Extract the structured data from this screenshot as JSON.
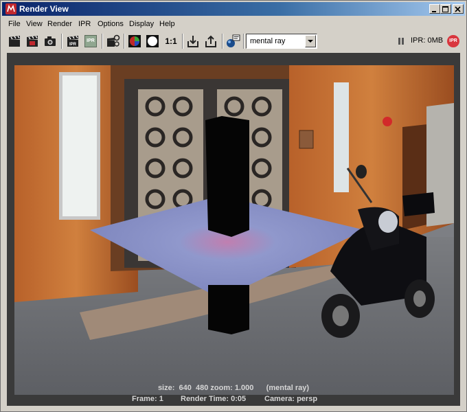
{
  "window": {
    "title": "Render View"
  },
  "menu": [
    "File",
    "View",
    "Render",
    "IPR",
    "Options",
    "Display",
    "Help"
  ],
  "toolbar": {
    "one_to_one_label": "1:1",
    "renderer": "mental ray",
    "ipr_memory": "IPR: 0MB",
    "ipr_badge": "IPR",
    "ipr_icon_text": "IPR"
  },
  "render_info": {
    "size_zoom": "size:  640  480 zoom: 1.000      (mental ray)"
  },
  "status": {
    "frame": "Frame: 1",
    "render_time": "Render Time: 0:05",
    "camera": "Camera: persp"
  },
  "colors": {
    "title_bar": "#0a246a",
    "window_bg": "#d4d0c8",
    "viewport_bg": "#3a3a3a",
    "ground_plane": "#8a90c8",
    "ipr_red": "#d9363e"
  }
}
